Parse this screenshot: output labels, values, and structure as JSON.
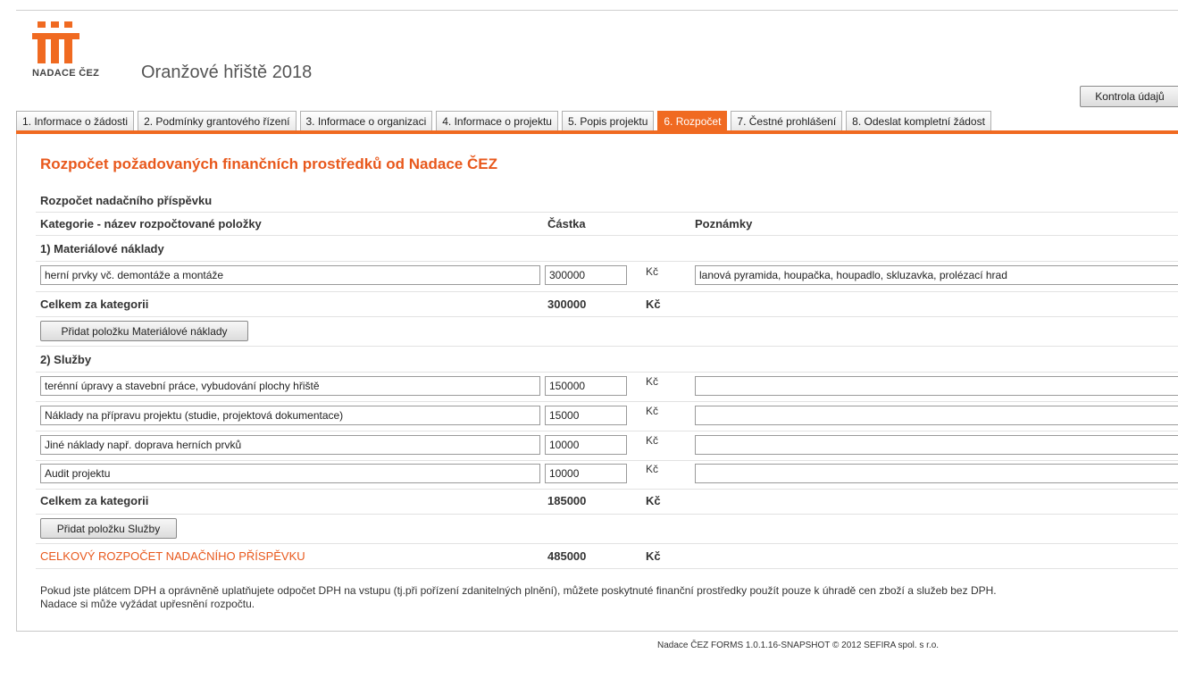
{
  "header": {
    "logo_text": "NADACE ČEZ",
    "app_title": "Oranžové hřiště 2018",
    "check_button": "Kontrola údajů"
  },
  "tabs": [
    {
      "label": "1. Informace o žádosti"
    },
    {
      "label": "2. Podmínky grantového řízení"
    },
    {
      "label": "3. Informace o organizaci"
    },
    {
      "label": "4. Informace o projektu"
    },
    {
      "label": "5. Popis projektu"
    },
    {
      "label": "6. Rozpočet",
      "active": true
    },
    {
      "label": "7. Čestné prohlášení"
    },
    {
      "label": "8. Odeslat kompletní žádost"
    }
  ],
  "main": {
    "heading": "Rozpočet požadovaných finančních prostředků od Nadace ČEZ",
    "section_title": "Rozpočet nadačního příspěvku",
    "columns": {
      "category": "Kategorie - název rozpočtované položky",
      "amount": "Částka",
      "notes": "Poznámky"
    },
    "currency": "Kč",
    "categories": [
      {
        "title": "1) Materiálové náklady",
        "items": [
          {
            "name": "herní prvky vč. demontáže a montáže",
            "amount": "300000",
            "note": "lanová pyramida, houpačka, houpadlo, skluzavka, prolézací hrad"
          }
        ],
        "total_label": "Celkem za kategorii",
        "total": "300000",
        "add_button": "Přidat položku Materiálové náklady"
      },
      {
        "title": "2) Služby",
        "items": [
          {
            "name": "terénní úpravy a stavební práce, vybudování plochy hřiště",
            "amount": "150000",
            "note": ""
          },
          {
            "name": "Náklady na přípravu projektu (studie, projektová dokumentace)",
            "amount": "15000",
            "note": ""
          },
          {
            "name": "Jiné náklady např. doprava herních prvků",
            "amount": "10000",
            "note": ""
          },
          {
            "name": "Audit projektu",
            "amount": "10000",
            "note": ""
          }
        ],
        "total_label": "Celkem za kategorii",
        "total": "185000",
        "add_button": "Přidat položku Služby"
      }
    ],
    "grand_total_label": "CELKOVÝ ROZPOČET NADAČNÍHO PŘÍSPĚVKU",
    "grand_total": "485000",
    "note_line1": "Pokud jste plátcem DPH a oprávněně uplatňujete odpočet DPH na vstupu (tj.při pořízení zdanitelných plnění), můžete poskytnuté finanční prostředky použít pouze k úhradě cen zboží a služeb bez DPH.",
    "note_line2": "Nadace si může vyžádat upřesnění rozpočtu."
  },
  "footer": {
    "text": "Nadace ČEZ FORMS 1.0.1.16-SNAPSHOT © 2012 SEFIRA spol. s r.o."
  },
  "colors": {
    "accent": "#f06a21",
    "heading": "#e8581c"
  }
}
